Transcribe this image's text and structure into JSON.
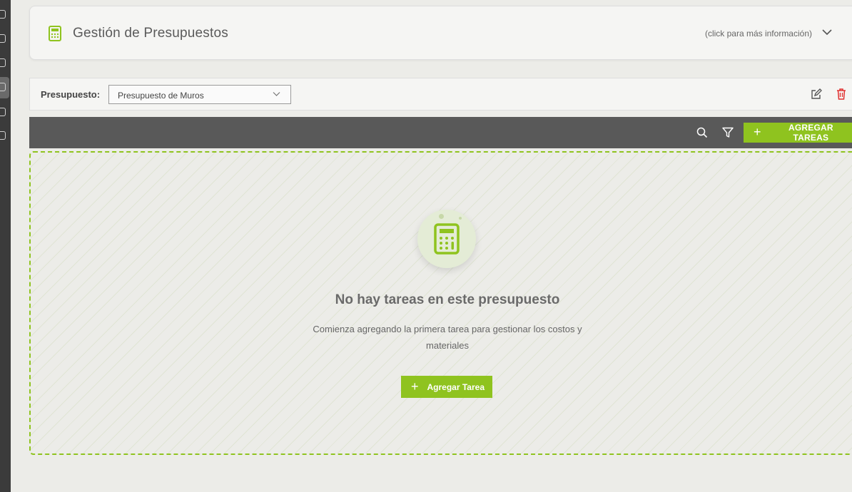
{
  "header": {
    "title": "Gestión de Presupuestos",
    "hint": "(click para más información)",
    "icon": "calculator-icon"
  },
  "budget": {
    "label": "Presupuesto:",
    "selected": "Presupuesto de Muros"
  },
  "toolbar": {
    "add_label": "AGREGAR TAREAS"
  },
  "empty_state": {
    "title": "No hay tareas en este presupuesto",
    "subtitle": "Comienza agregando la primera tarea para gestionar los costos y materiales",
    "add_label": "Agregar Tarea"
  },
  "colors": {
    "accent": "#8fc31f",
    "toolbar": "#595959",
    "sidebar": "#3b3b3b",
    "danger": "#e03030"
  }
}
